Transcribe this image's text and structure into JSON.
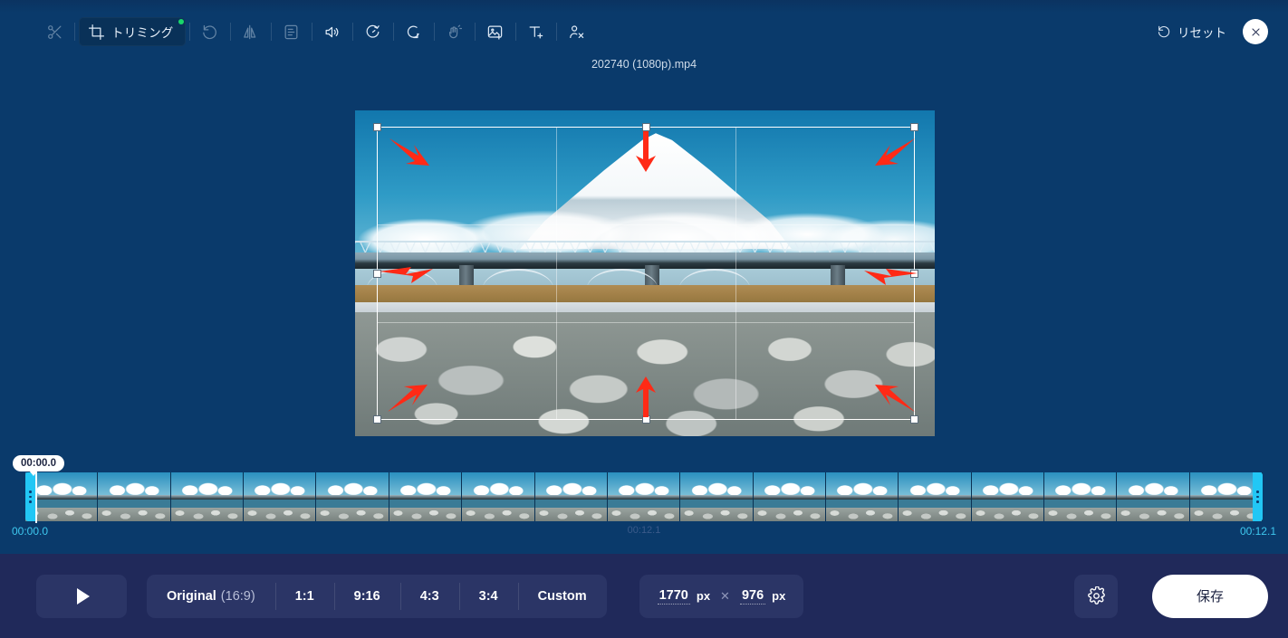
{
  "window": {
    "file_name": "202740 (1080p).mp4"
  },
  "toolbar": {
    "items": [
      {
        "name": "cut",
        "icon": "scissors-icon",
        "label": "",
        "active": false,
        "badge": false
      },
      {
        "name": "trim",
        "icon": "crop-icon",
        "label": "トリミング",
        "active": true,
        "badge": true
      },
      {
        "name": "rotate",
        "icon": "rotate-left-icon",
        "label": "",
        "active": false,
        "badge": false
      },
      {
        "name": "flip",
        "icon": "flip-horizontal-icon",
        "label": "",
        "active": false,
        "badge": false
      },
      {
        "name": "subtitle",
        "icon": "subtitle-icon",
        "label": "",
        "active": false,
        "badge": false
      },
      {
        "name": "volume",
        "icon": "speaker-icon",
        "label": "",
        "active": false,
        "badge": false
      },
      {
        "name": "speed",
        "icon": "speed-icon",
        "label": "",
        "active": false,
        "badge": false
      },
      {
        "name": "loop",
        "icon": "loop-icon",
        "label": "",
        "active": false,
        "badge": false
      },
      {
        "name": "denoise",
        "icon": "hand-wave-icon",
        "label": "",
        "active": false,
        "badge": false
      },
      {
        "name": "add-image",
        "icon": "image-plus-icon",
        "label": "",
        "active": false,
        "badge": false
      },
      {
        "name": "add-text",
        "icon": "text-plus-icon",
        "label": "",
        "active": false,
        "badge": false
      },
      {
        "name": "remove-watermark",
        "icon": "stamp-remove-icon",
        "label": "",
        "active": false,
        "badge": false
      }
    ],
    "reset_label": "リセット",
    "reset_icon": "undo-icon",
    "close_icon": "close-icon"
  },
  "preview": {
    "crop": {
      "handles": 8,
      "grid": "rule-of-thirds",
      "arrow_count": 8
    }
  },
  "timeline": {
    "tooltip_time": "00:00.0",
    "start_time": "00:00.0",
    "mid_time": "00:12.1",
    "end_time": "00:12.1",
    "frame_count": 17,
    "handle_color": "#22c7f5"
  },
  "controls": {
    "play_icon": "play-icon",
    "ratios": [
      {
        "label": "Original",
        "sub": "(16:9)",
        "selected": true
      },
      {
        "label": "1:1",
        "sub": "",
        "selected": false
      },
      {
        "label": "9:16",
        "sub": "",
        "selected": false
      },
      {
        "label": "4:3",
        "sub": "",
        "selected": false
      },
      {
        "label": "3:4",
        "sub": "",
        "selected": false
      },
      {
        "label": "Custom",
        "sub": "",
        "selected": false
      }
    ],
    "size": {
      "width": "1770",
      "height": "976",
      "unit": "px",
      "separator": "✕"
    },
    "settings_icon": "gear-icon",
    "save_label": "保存"
  },
  "colors": {
    "background": "#0a3a6b",
    "bottom_bar": "#20295a",
    "control_fill": "#2b3566",
    "accent_cyan": "#22c7f5",
    "badge_green": "#19d66a",
    "arrow_red": "#ff2a16",
    "save_bg": "#ffffff"
  }
}
